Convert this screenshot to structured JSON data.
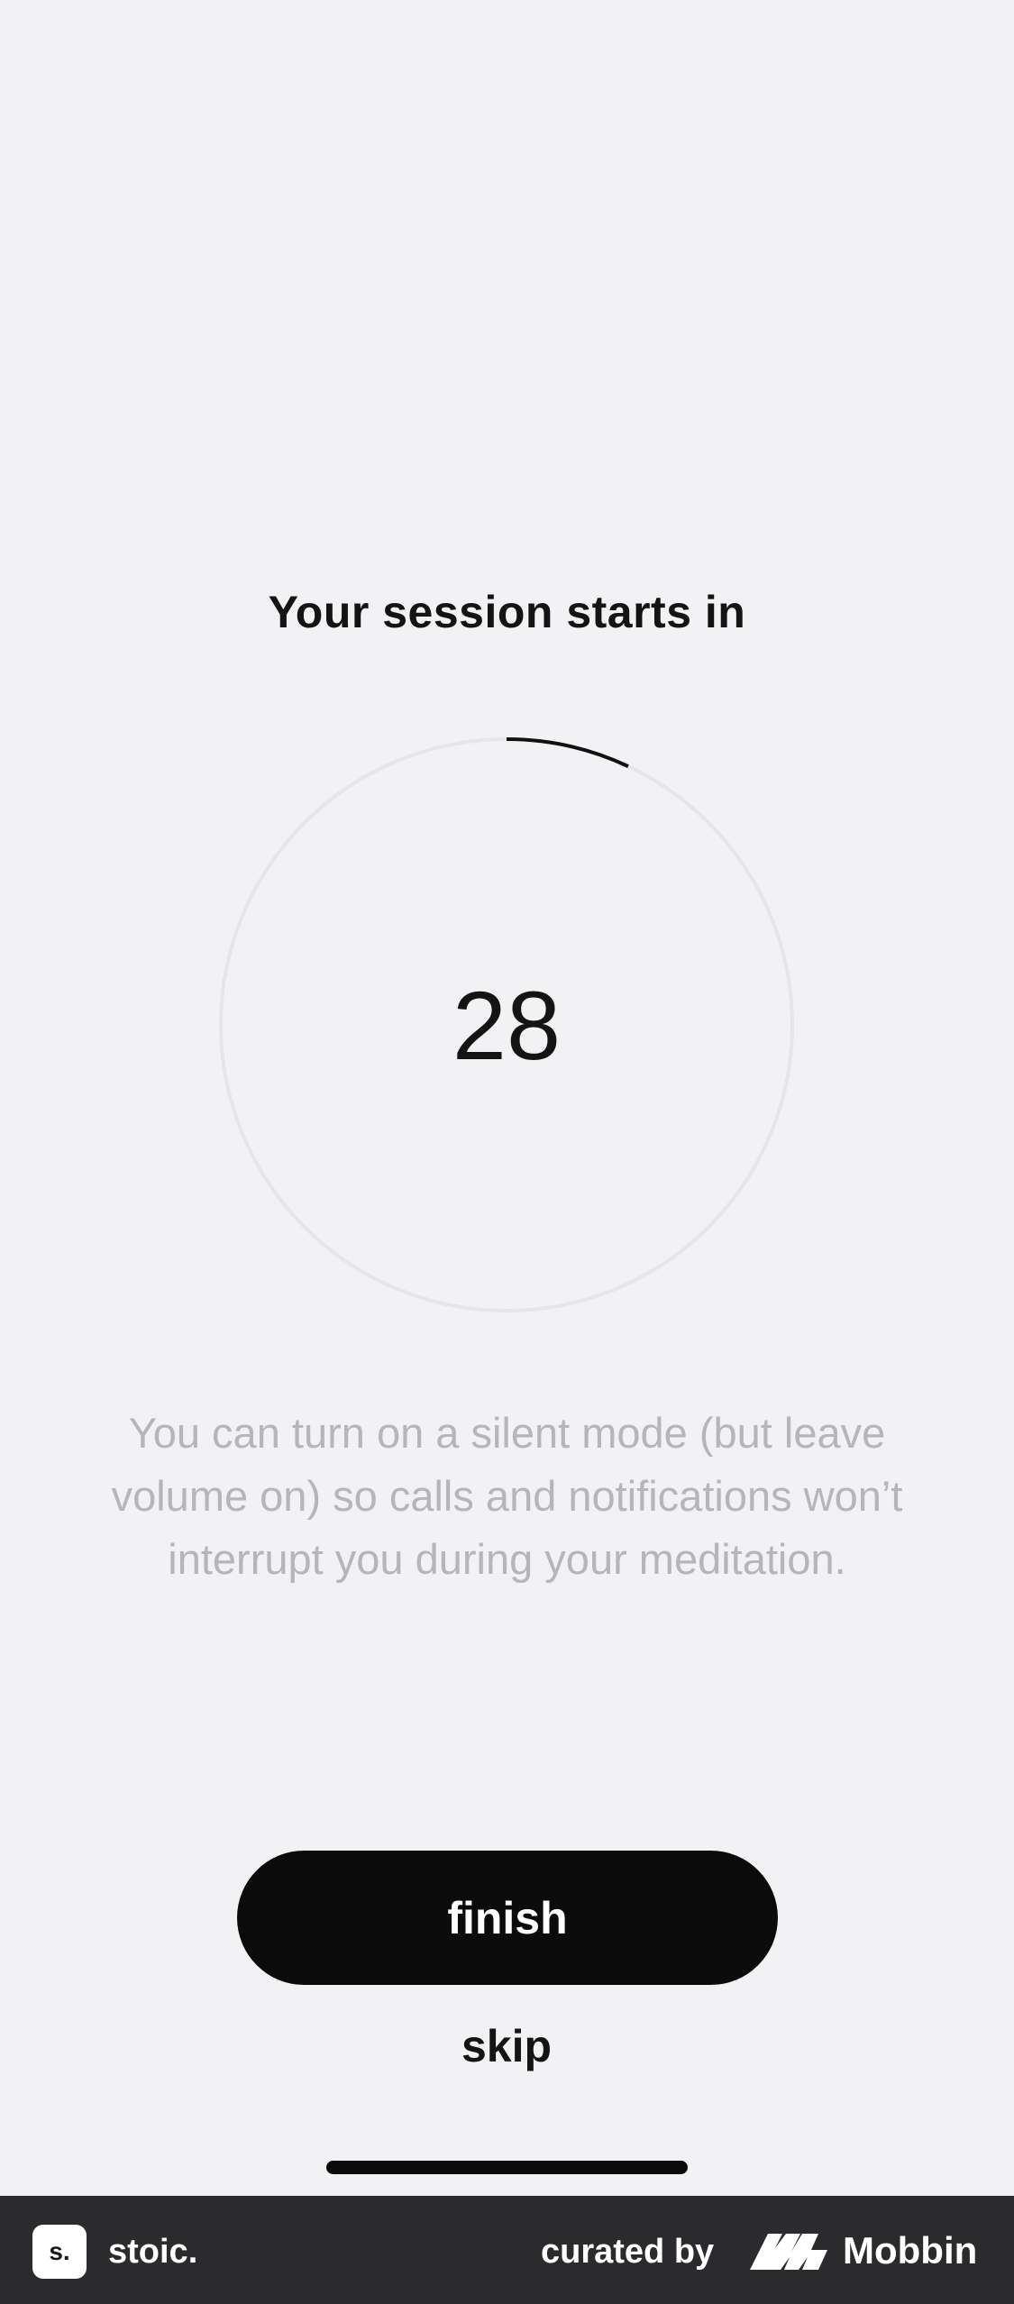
{
  "session": {
    "title": "Your session starts in",
    "countdown": "28",
    "progress_fraction": 0.07
  },
  "hint": {
    "text": "You can turn on a silent mode (but leave volume on) so calls and notifications won’t interrupt you during your meditation."
  },
  "actions": {
    "finish_label": "finish",
    "skip_label": "skip"
  },
  "footer": {
    "app_logo_text": "s.",
    "app_name": "stoic.",
    "curated_by": "curated by",
    "brand_name": "Mobbin",
    "brand_icon": "mobbin-logo-icon"
  },
  "colors": {
    "background": "#f2f2f4",
    "button": "#0b0b0b",
    "ring_track": "#e6e6e8",
    "ring_progress": "#111111",
    "hint_text": "#b6b6b9",
    "footer_bg": "#2b2b2d"
  }
}
